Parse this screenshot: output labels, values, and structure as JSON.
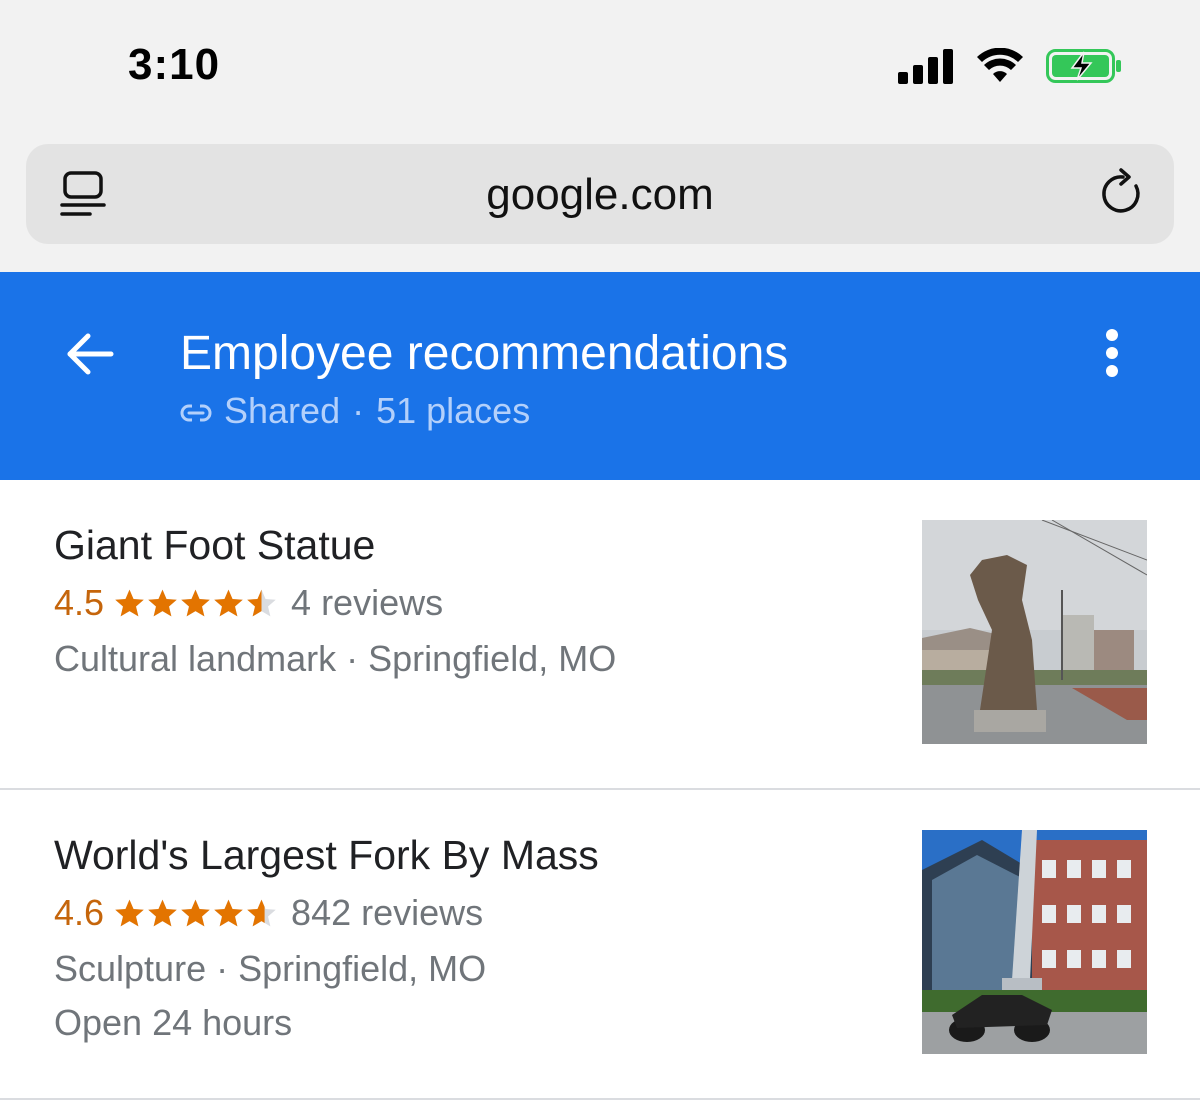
{
  "status": {
    "time": "3:10"
  },
  "browser": {
    "url": "google.com"
  },
  "header": {
    "title": "Employee recommendations",
    "shared_label": "Shared",
    "separator": "·",
    "places": "51 places"
  },
  "places": [
    {
      "name": "Giant Foot Statue",
      "rating": "4.5",
      "stars": 4.5,
      "reviews": "4 reviews",
      "category_location": "Cultural landmark · Springfield, MO",
      "hours": ""
    },
    {
      "name": "World's Largest Fork By Mass",
      "rating": "4.6",
      "stars": 4.6,
      "reviews": "842 reviews",
      "category_location": "Sculpture · Springfield, MO",
      "hours": "Open 24 hours"
    }
  ],
  "colors": {
    "header_bg": "#1a73e8",
    "star": "#e37400",
    "rating_text": "#c5650b",
    "battery": "#34c759"
  }
}
